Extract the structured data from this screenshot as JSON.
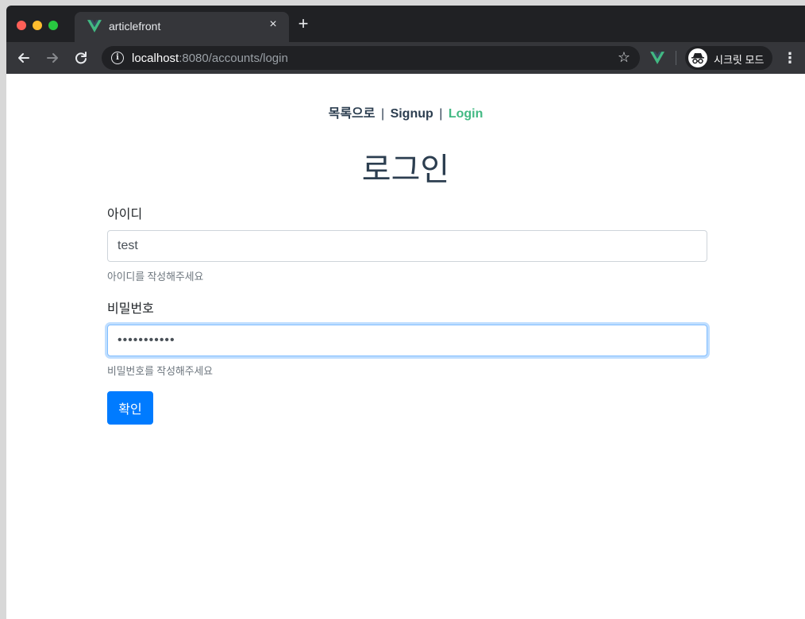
{
  "browser": {
    "tab_title": "articlefront",
    "tab_close": "×",
    "new_tab": "+",
    "url_host": "localhost",
    "url_rest": ":8080/accounts/login",
    "incognito_label": "시크릿 모드",
    "icons": {
      "back": "arrow-left-icon",
      "forward": "arrow-right-icon",
      "reload": "reload-icon",
      "info": "info-icon",
      "bookmark": "star-icon",
      "extension": "vue-icon",
      "incognito": "incognito-icon",
      "menu": "more-vertical-icon"
    },
    "colors": {
      "frame": "#202124",
      "toolbar": "#35363a",
      "vue_green": "#42b983"
    }
  },
  "nav": {
    "list_link": "목록으로",
    "separator": "|",
    "signup_link": "Signup",
    "login_link": "Login"
  },
  "page": {
    "title": "로그인"
  },
  "form": {
    "username": {
      "label": "아이디",
      "value": "test",
      "help": "아이디를 작성해주세요"
    },
    "password": {
      "label": "비밀번호",
      "value": "•••••••••••",
      "help": "비밀번호를 작성해주세요"
    },
    "submit_label": "확인"
  },
  "colors": {
    "text": "#2c3e50",
    "active_link": "#42b983",
    "primary_button": "#007bff",
    "focus_border": "#80bdff"
  }
}
